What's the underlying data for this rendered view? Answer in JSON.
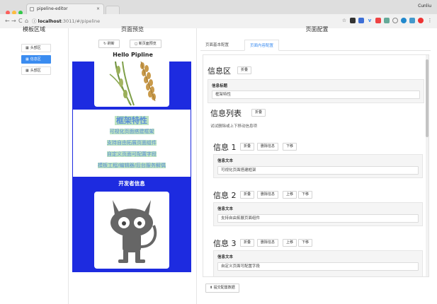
{
  "browser": {
    "tab_title": "pipeline-editor",
    "tab_close": "×",
    "user_name": "Cunliu",
    "url_host": "localhost",
    "url_path": ":3011/#/pipeline",
    "nav_back": "←",
    "nav_forward": "→",
    "nav_reload": "C",
    "nav_home": "⌂",
    "info_icon": "ⓘ",
    "star": "☆",
    "menu": "⋮",
    "traffic_colors": [
      "#fc605c",
      "#fdbc40",
      "#34c84a"
    ]
  },
  "left_panel": {
    "heading": "模板区域",
    "templates": [
      {
        "icon": "grid-icon",
        "label": "头部区",
        "active": false
      },
      {
        "icon": "grid-icon",
        "label": "信息区",
        "active": true
      },
      {
        "icon": "grid-icon",
        "label": "头部区",
        "active": false
      }
    ]
  },
  "middle_panel": {
    "heading": "页面预览",
    "refresh_label": "刷新",
    "newpage_label": "新页面预览",
    "preview_title": "Hello Pipline",
    "info_title": "框架特性",
    "info_lines": [
      "可视化页面搭建框架",
      "支持自由拓展页面组件",
      "自定义页面可配置字段",
      "模板工程/编辑器/后台服务解偶"
    ],
    "dev_title": "开发者信息",
    "accent_color": "#1d2be0"
  },
  "right_panel": {
    "heading": "页面配置",
    "tabs": [
      {
        "label": "页面基本配置",
        "active": false
      },
      {
        "label": "页面内容配置",
        "active": true
      }
    ],
    "section_title": "信息区",
    "fold_label": "折叠",
    "info_title_label": "信息标题",
    "info_title_value": "框架特性",
    "list_title": "信息列表",
    "list_hint": "试试删除或上下移动信息项",
    "delete_label": "删除信息",
    "up_label": "上移",
    "down_label": "下移",
    "text_label": "信息文本",
    "items": [
      {
        "title": "信息 1",
        "text": "可视化页面搭建框架"
      },
      {
        "title": "信息 2",
        "text": "支持自由拓展页面组件"
      },
      {
        "title": "信息 3",
        "text": "自定义页面可配置字段"
      }
    ],
    "submit_label": "提交配置数据",
    "accent_color": "#3b8cf0"
  }
}
